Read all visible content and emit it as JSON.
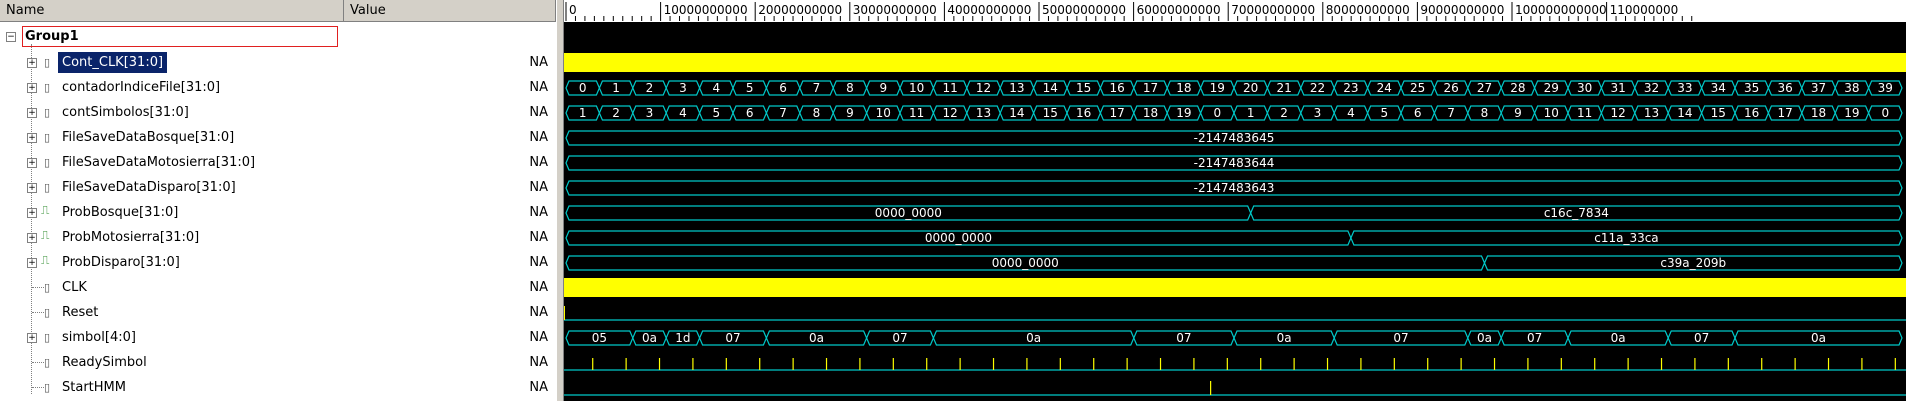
{
  "header": {
    "name_label": "Name",
    "value_label": "Value"
  },
  "group": {
    "label": "Group1"
  },
  "signals": [
    {
      "name": "Cont_CLK[31:0]",
      "value": "NA",
      "icon": "bus-icon",
      "selected": true
    },
    {
      "name": "contadorIndiceFile[31:0]",
      "value": "NA",
      "icon": "bus-icon"
    },
    {
      "name": "contSimbolos[31:0]",
      "value": "NA",
      "icon": "bus-icon"
    },
    {
      "name": "FileSaveDataBosque[31:0]",
      "value": "NA",
      "icon": "bus-icon"
    },
    {
      "name": "FileSaveDataMotosierra[31:0]",
      "value": "NA",
      "icon": "bus-icon"
    },
    {
      "name": "FileSaveDataDisparo[31:0]",
      "value": "NA",
      "icon": "bus-icon"
    },
    {
      "name": "ProbBosque[31:0]",
      "value": "NA",
      "icon": "analog-icon"
    },
    {
      "name": "ProbMotosierra[31:0]",
      "value": "NA",
      "icon": "analog-icon"
    },
    {
      "name": "ProbDisparo[31:0]",
      "value": "NA",
      "icon": "analog-icon"
    },
    {
      "name": "CLK",
      "value": "NA",
      "icon": "signal-icon"
    },
    {
      "name": "Reset",
      "value": "NA",
      "icon": "signal-icon"
    },
    {
      "name": "simbol[4:0]",
      "value": "NA",
      "icon": "bus-icon"
    },
    {
      "name": "ReadySimbol",
      "value": "NA",
      "icon": "signal-icon"
    },
    {
      "name": "StartHMM",
      "value": "NA",
      "icon": "signal-icon"
    }
  ],
  "ruler": {
    "labels": [
      "0",
      "10000000000",
      "20000000000",
      "30000000000",
      "40000000000",
      "50000000000",
      "60000000000",
      "70000000000",
      "80000000000",
      "90000000000",
      "100000000000",
      "110000000"
    ]
  },
  "waves": {
    "cont_clk": {
      "kind": "solid",
      "color": "#ffff00"
    },
    "contadorIndiceFile": {
      "values": [
        "0",
        "1",
        "2",
        "3",
        "4",
        "5",
        "6",
        "7",
        "8",
        "9",
        "10",
        "11",
        "12",
        "13",
        "14",
        "15",
        "16",
        "17",
        "18",
        "19",
        "20",
        "21",
        "22",
        "23",
        "24",
        "25",
        "26",
        "27",
        "28",
        "29",
        "30",
        "31",
        "32",
        "33",
        "34",
        "35",
        "36",
        "37",
        "38",
        "39"
      ]
    },
    "contSimbolos": {
      "values": [
        "1",
        "2",
        "3",
        "4",
        "5",
        "6",
        "7",
        "8",
        "9",
        "10",
        "11",
        "12",
        "13",
        "14",
        "15",
        "16",
        "17",
        "18",
        "19",
        "0",
        "1",
        "2",
        "3",
        "4",
        "5",
        "6",
        "7",
        "8",
        "9",
        "10",
        "11",
        "12",
        "13",
        "14",
        "15",
        "16",
        "17",
        "18",
        "19",
        "0"
      ]
    },
    "FileSaveDataBosque": {
      "value": "-2147483645"
    },
    "FileSaveDataMotosierra": {
      "value": "-2147483644"
    },
    "FileSaveDataDisparo": {
      "value": "-2147483643"
    },
    "ProbBosque": {
      "segments": [
        {
          "value": "0000_0000",
          "from": 0,
          "to": 20.5
        },
        {
          "value": "c16c_7834",
          "from": 20.5,
          "to": 40
        }
      ]
    },
    "ProbMotosierra": {
      "segments": [
        {
          "value": "0000_0000",
          "from": 0,
          "to": 23.5
        },
        {
          "value": "c11a_33ca",
          "from": 23.5,
          "to": 40
        }
      ]
    },
    "ProbDisparo": {
      "segments": [
        {
          "value": "0000_0000",
          "from": 0,
          "to": 27.5
        },
        {
          "value": "c39a_209b",
          "from": 27.5,
          "to": 40
        }
      ]
    },
    "clk": {
      "kind": "solid",
      "color": "#ffff00"
    },
    "reset": {
      "kind": "low"
    },
    "simbol": {
      "segments": [
        {
          "value": "05",
          "from": 0,
          "to": 2
        },
        {
          "value": "0a",
          "from": 2,
          "to": 3
        },
        {
          "value": "1d",
          "from": 3,
          "to": 4
        },
        {
          "value": "07",
          "from": 4,
          "to": 6
        },
        {
          "value": "0a",
          "from": 6,
          "to": 9
        },
        {
          "value": "07",
          "from": 9,
          "to": 11
        },
        {
          "value": "0a",
          "from": 11,
          "to": 17
        },
        {
          "value": "07",
          "from": 17,
          "to": 20
        },
        {
          "value": "0a",
          "from": 20,
          "to": 23
        },
        {
          "value": "07",
          "from": 23,
          "to": 27
        },
        {
          "value": "0a",
          "from": 27,
          "to": 28
        },
        {
          "value": "07",
          "from": 28,
          "to": 30
        },
        {
          "value": "0a",
          "from": 30,
          "to": 33
        },
        {
          "value": "07",
          "from": 33,
          "to": 35
        },
        {
          "value": "0a",
          "from": 35,
          "to": 40
        }
      ]
    },
    "readySimbol": {
      "pulse_count": 40
    },
    "startHMM": {
      "pulse_at": 19.3
    }
  },
  "colors": {
    "wave_line": "#00c8c8",
    "wave_text": "#ffffff",
    "highlight": "#ffff00",
    "selection": "#0a246a",
    "group_border": "#e02020"
  }
}
